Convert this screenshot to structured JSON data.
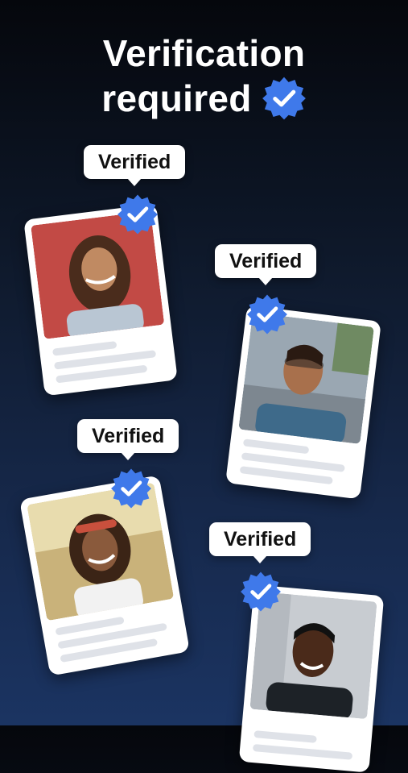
{
  "headline": {
    "line1": "Verification",
    "line2": "required"
  },
  "cards": [
    {
      "badge_label": "Verified",
      "person": "woman-curly-hair",
      "photo_bg": "#c24a45"
    },
    {
      "badge_label": "Verified",
      "person": "man-glasses",
      "photo_bg": "#9aa7b2"
    },
    {
      "badge_label": "Verified",
      "person": "woman-headband",
      "photo_bg": "#c9b27a"
    },
    {
      "badge_label": "Verified",
      "person": "man-short-hair",
      "photo_bg": "#c8ccd1"
    }
  ],
  "colors": {
    "accent_blue": "#3f79ea",
    "background_top": "#05070c",
    "background_bottom": "#1b3462"
  },
  "icons": {
    "verified": "verified-badge-icon"
  }
}
